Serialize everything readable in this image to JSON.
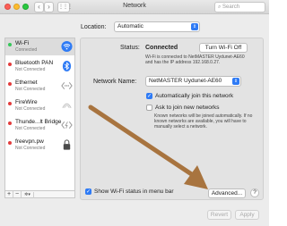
{
  "window": {
    "title": "Network",
    "search_placeholder": "Search",
    "back": "‹",
    "forward": "›",
    "grid": "⋮⋮⋮"
  },
  "location": {
    "label": "Location:",
    "value": "Automatic"
  },
  "services": [
    {
      "name": "Wi-Fi",
      "status": "Connected",
      "dot": "#35c759",
      "icon": "wifi-icon"
    },
    {
      "name": "Bluetooth PAN",
      "status": "Not Connected",
      "dot": "#e23c3c",
      "icon": "bluetooth-icon"
    },
    {
      "name": "Ethernet",
      "status": "Not Connected",
      "dot": "#e23c3c",
      "icon": "ethernet-icon"
    },
    {
      "name": "FireWire",
      "status": "Not Connected",
      "dot": "#e23c3c",
      "icon": "firewire-icon"
    },
    {
      "name": "Thunde...lt Bridge",
      "status": "Not Connected",
      "dot": "#e23c3c",
      "icon": "thunderbolt-bridge-icon"
    },
    {
      "name": "freevpn.pw",
      "status": "Not Connected",
      "dot": "#e23c3c",
      "icon": "vpn-lock-icon"
    }
  ],
  "sidebar_controls": {
    "add": "+",
    "remove": "−",
    "action": "✲▾"
  },
  "status": {
    "label": "Status:",
    "value": "Connected",
    "button": "Turn Wi-Fi Off",
    "description": "Wi-Fi is connected to NetMASTER Uydunet-AE60 and has the IP address 192.168.0.27."
  },
  "network_name": {
    "label": "Network Name:",
    "value": "NetMASTER Uydunet-AE60"
  },
  "options": {
    "auto_join": {
      "label": "Automatically join this network",
      "checked": true
    },
    "ask_join": {
      "label": "Ask to join new networks",
      "checked": false,
      "description": "Known networks will be joined automatically. If no known networks are available, you will have to manually select a network."
    }
  },
  "show_wifi": {
    "label": "Show Wi-Fi status in menu bar",
    "checked": true
  },
  "buttons": {
    "advanced": "Advanced...",
    "help": "?",
    "revert": "Revert",
    "apply": "Apply"
  },
  "colors": {
    "accent": "#2f7bf5",
    "annotation_arrow": "#a8743f"
  }
}
